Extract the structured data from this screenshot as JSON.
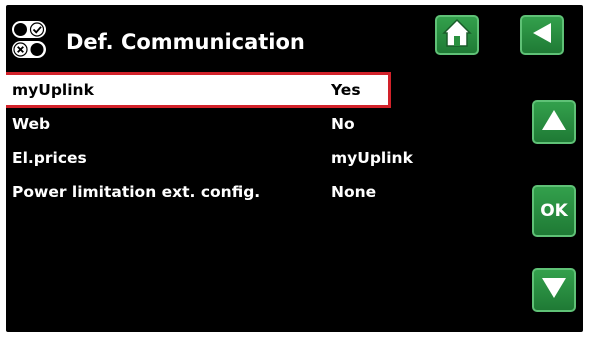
{
  "header": {
    "title": "Def. Communication",
    "icon": "communication-settings-icon"
  },
  "nav": {
    "home_icon": "home-icon",
    "back_icon": "back-arrow-icon",
    "up_icon": "up-arrow-icon",
    "ok_label": "OK",
    "down_icon": "down-arrow-icon",
    "button_color": "#2a9140"
  },
  "menu": {
    "selection_color": "#d2222a",
    "items": [
      {
        "label": "myUplink",
        "value": "Yes",
        "selected": true
      },
      {
        "label": "Web",
        "value": "No",
        "selected": false
      },
      {
        "label": "El.prices",
        "value": "myUplink",
        "selected": false
      },
      {
        "label": "Power limitation ext. config.",
        "value": "None",
        "selected": false
      }
    ]
  }
}
